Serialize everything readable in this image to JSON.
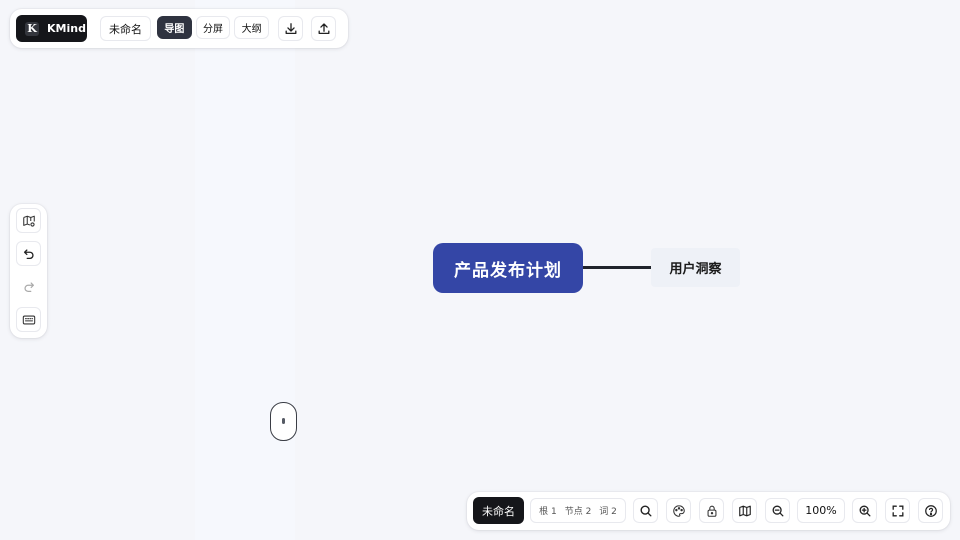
{
  "app": {
    "name": "KMind",
    "logo_letter": "K"
  },
  "top_bar": {
    "file_name": "未命名",
    "view_modes": [
      {
        "label": "导图",
        "active": true
      },
      {
        "label": "分屏",
        "active": false
      },
      {
        "label": "大纲",
        "active": false
      }
    ],
    "actions": [
      {
        "name": "download-icon"
      },
      {
        "name": "upload-icon"
      }
    ]
  },
  "left_bar": {
    "tools": [
      {
        "name": "map-settings-icon"
      },
      {
        "name": "undo-icon"
      },
      {
        "name": "redo-icon",
        "disabled": true
      },
      {
        "name": "keyboard-icon"
      }
    ]
  },
  "canvas": {
    "root_node": "产品发布计划",
    "child_nodes": [
      "用户洞察"
    ],
    "colors": {
      "root_fill": "#3446a6",
      "child_fill": "#eef1f7",
      "connector": "#20232b"
    }
  },
  "bottom_bar": {
    "doc_name": "未命名",
    "stats": {
      "roots": "根 1",
      "nodes": "节点 2",
      "words": "词 2"
    },
    "zoom": "100%",
    "tools": [
      "search-icon",
      "theme-icon",
      "lock-icon",
      "map-icon",
      "zoom-out-icon",
      "zoom-in-icon",
      "fullscreen-icon",
      "help-icon"
    ]
  }
}
